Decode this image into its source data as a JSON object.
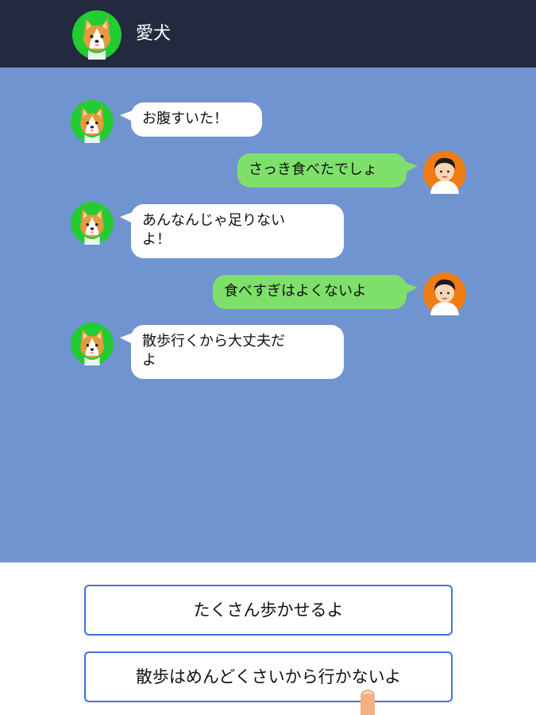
{
  "header": {
    "title": "愛犬",
    "avatar_icon": "corgi-dog-icon"
  },
  "chat": {
    "messages": [
      {
        "sender": "dog",
        "text": "お腹すいた！",
        "avatar_icon": "corgi-dog-icon"
      },
      {
        "sender": "user",
        "text": "さっき食べたでしょ",
        "avatar_icon": "boy-avatar-icon"
      },
      {
        "sender": "dog",
        "text": "あんなんじゃ足りない\nよ！",
        "avatar_icon": "corgi-dog-icon"
      },
      {
        "sender": "user",
        "text": "食べすぎはよくないよ",
        "avatar_icon": "boy-avatar-icon"
      },
      {
        "sender": "dog",
        "text": "散歩行くから大丈夫だ\nよ",
        "avatar_icon": "corgi-dog-icon"
      }
    ]
  },
  "choices": [
    {
      "label": "たくさん歩かせるよ"
    },
    {
      "label": "散歩はめんどくさいから行かないよ"
    }
  ],
  "colors": {
    "header_bg": "#232a3f",
    "chat_bg": "#7094d0",
    "dog_bubble": "#ffffff",
    "user_bubble": "#7ee06b",
    "dog_avatar_bg": "#22cc33",
    "user_avatar_bg": "#f07c14",
    "choice_border": "#3f72d8"
  }
}
